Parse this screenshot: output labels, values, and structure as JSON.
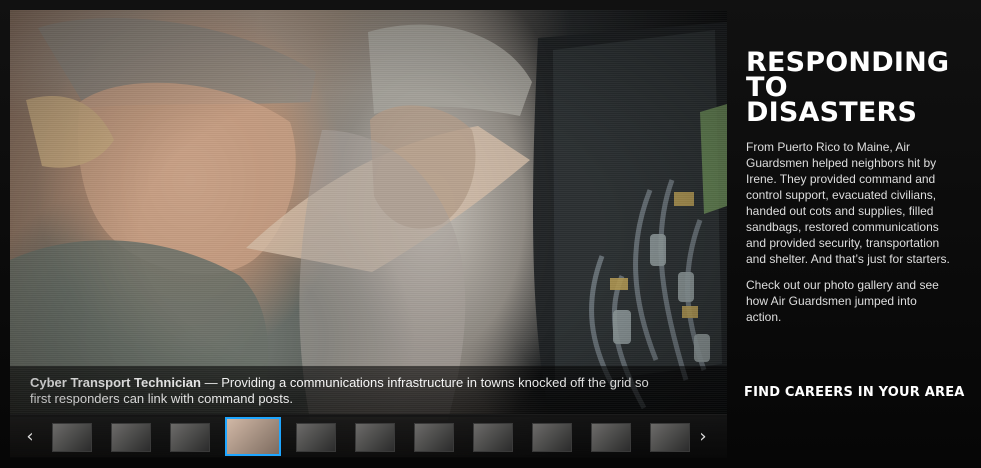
{
  "hero": {
    "caption": {
      "title": "Cyber Transport Technician",
      "text": " — Providing a communications infrastructure in towns knocked off the grid so first responders can link with command posts."
    },
    "thumbnails": [
      {
        "label": "thumb-1"
      },
      {
        "label": "thumb-2"
      },
      {
        "label": "thumb-3"
      },
      {
        "label": "thumb-4"
      },
      {
        "label": "thumb-5"
      },
      {
        "label": "thumb-6"
      },
      {
        "label": "thumb-7"
      },
      {
        "label": "thumb-8"
      },
      {
        "label": "thumb-9"
      },
      {
        "label": "thumb-10"
      },
      {
        "label": "thumb-11"
      }
    ],
    "active_thumb": 4
  },
  "sidebar": {
    "headline": "Responding to Disasters",
    "paragraph_1": "From Puerto Rico to Maine, Air Guardsmen helped neighbors hit by Irene. They provided command and control support, evacuated civilians, handed out cots and supplies, filled sandbags, restored communications and provided security, transportation and shelter. And that’s just for starters.",
    "paragraph_2": "Check out our photo gallery and see how Air Guardsmen jumped into action.",
    "cta": "FIND CAREERS IN YOUR AREA"
  },
  "icons": {
    "left_arrow": "chevron-left-icon",
    "right_arrow": "chevron-right-icon"
  },
  "colors": {
    "accent": "#1ea6ff",
    "background": "#050505",
    "text": "#ffffff"
  }
}
